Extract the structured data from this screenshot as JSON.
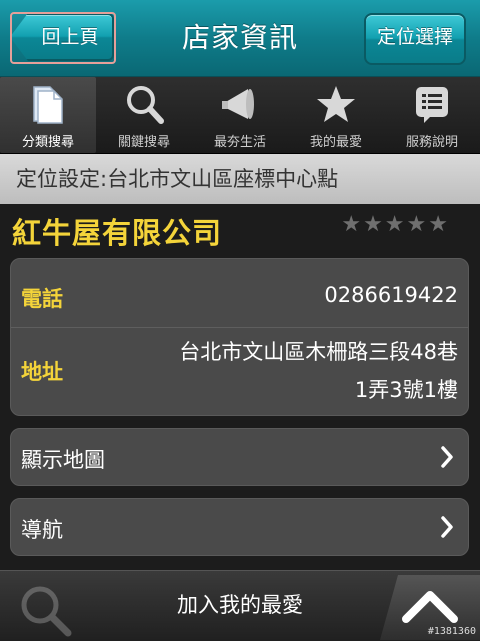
{
  "header": {
    "back_label": "回上頁",
    "title": "店家資訊",
    "location_button_label": "定位選擇"
  },
  "tabs": [
    {
      "label": "分類搜尋",
      "icon": "folder-icon",
      "active": true
    },
    {
      "label": "關鍵搜尋",
      "icon": "search-icon",
      "active": false
    },
    {
      "label": "最夯生活",
      "icon": "megaphone-icon",
      "active": false
    },
    {
      "label": "我的最愛",
      "icon": "star-icon",
      "active": false
    },
    {
      "label": "服務說明",
      "icon": "list-icon",
      "active": false
    }
  ],
  "location_setting": "定位設定:台北市文山區座標中心點",
  "store": {
    "name": "紅牛屋有限公司",
    "rating_stars_filled": 0,
    "rating_stars_total": 5
  },
  "info": {
    "phone_label": "電話",
    "phone_value": "0286619422",
    "address_label": "地址",
    "address_line1": "台北市文山區木柵路三段48巷",
    "address_line2": "1弄3號1樓"
  },
  "actions": {
    "map_label": "顯示地圖",
    "navigate_label": "導航",
    "add_favorite_label": "加入我的最愛"
  },
  "watermark": "#1381360",
  "colors": {
    "accent_teal": "#12a0b0",
    "label_gold": "#f4d43a",
    "card_bg": "#4a4a4a"
  }
}
